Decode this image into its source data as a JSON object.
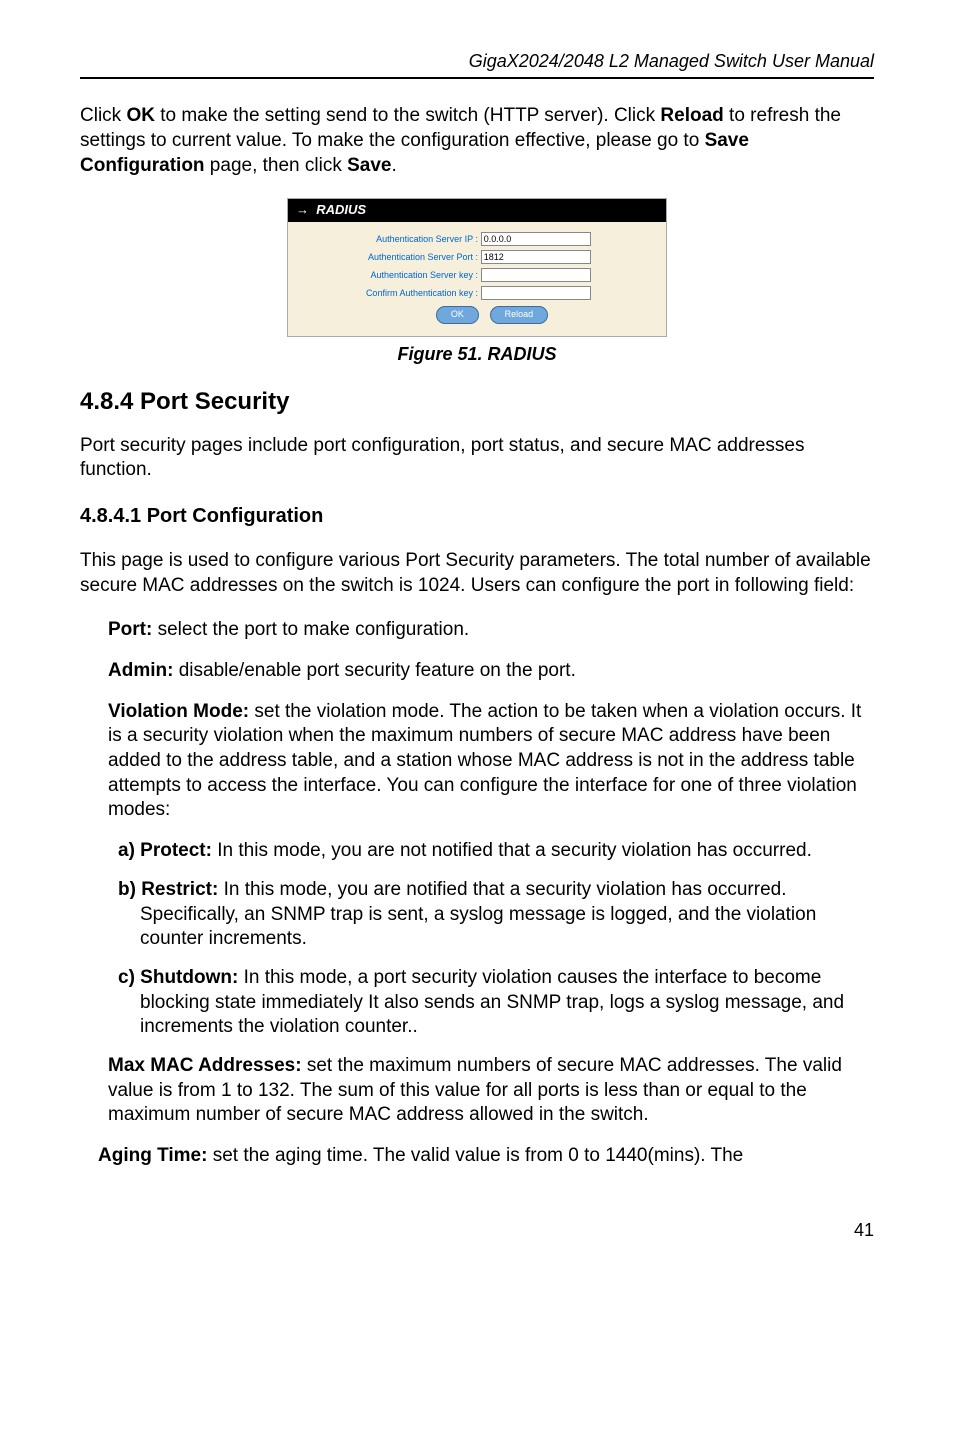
{
  "page_header": "GigaX2024/2048 L2 Managed Switch User Manual",
  "intro": {
    "part1": "Click ",
    "ok": "OK",
    "part2": " to make the setting send to the switch (HTTP server). Click ",
    "reload": "Reload",
    "part3": " to refresh the settings to current value. To make the configuration effective, please go to ",
    "save_config": "Save Configuration",
    "part4": " page, then click ",
    "save": "Save",
    "part5": "."
  },
  "radius": {
    "title": "RADIUS",
    "rows": {
      "ip_label": "Authentication Server IP :",
      "ip_value": "0.0.0.0",
      "port_label": "Authentication Server Port :",
      "port_value": "1812",
      "key_label": "Authentication Server key :",
      "confirm_key_label": "Confirm Authentication key :"
    },
    "buttons": {
      "ok": "OK",
      "reload": "Reload"
    }
  },
  "figure_caption": "Figure 51. RADIUS",
  "section_heading": "4.8.4 Port Security",
  "section_para": "Port security pages include port configuration, port status, and secure MAC addresses function.",
  "sub_heading": "4.8.4.1 Port Configuration",
  "sub_para": "This page is used to configure various Port Security parameters. The total number of available secure MAC addresses on the switch is 1024. Users can configure the port in following field:",
  "fields": {
    "port": {
      "label": "Port:",
      "text": " select the port to make configuration."
    },
    "admin": {
      "label": "Admin:",
      "text": " disable/enable port security feature on the port."
    },
    "violation": {
      "label": "Violation Mode:",
      "text": " set the violation mode. The action to be taken when a violation occurs. It is a security violation when the maximum numbers of secure MAC address have been added to the address table, and a station whose MAC address is not in the address table attempts to access the interface. You can configure the interface for one of three violation modes:"
    },
    "protect": {
      "prefix": "a) Protect:",
      "text": " In this mode, you are not notified that a security violation has occurred."
    },
    "restrict": {
      "prefix": "b) Restrict:",
      "text": " In this mode, you are notified that a security violation has occurred. Specifically, an SNMP trap is sent, a syslog message is logged, and the violation counter increments."
    },
    "shutdown": {
      "prefix": "c) Shutdown:",
      "text": " In this mode, a port security violation causes the interface to become blocking state immediately It also sends an SNMP trap, logs a syslog message, and increments the violation counter.."
    },
    "maxmac": {
      "label": "Max MAC Addresses:",
      "text": " set the maximum numbers of secure MAC addresses. The valid value is from 1 to 132. The sum of this value for all ports is less than or equal to the maximum number of secure MAC address allowed in the switch."
    },
    "aging": {
      "label": "Aging Time:",
      "text": " set the aging time. The valid value is from 0 to 1440(mins). The"
    }
  },
  "page_number": "41"
}
